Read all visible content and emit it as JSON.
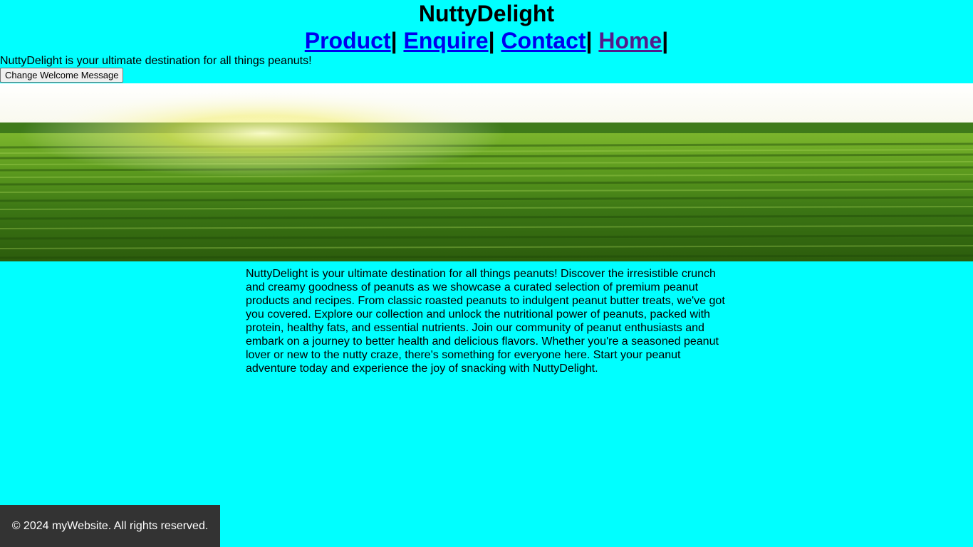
{
  "header": {
    "title": "NuttyDelight",
    "nav": [
      {
        "label": "Product"
      },
      {
        "label": "Enquire"
      },
      {
        "label": "Contact"
      },
      {
        "label": "Home"
      }
    ],
    "separator": "|"
  },
  "welcome": {
    "message": "NuttyDelight is your ultimate destination for all things peanuts!",
    "button_label": "Change Welcome Message"
  },
  "main": {
    "paragraph": "NuttyDelight is your ultimate destination for all things peanuts! Discover the irresistible crunch and creamy goodness of peanuts as we showcase a curated selection of premium peanut products and recipes. From classic roasted peanuts to indulgent peanut butter treats, we've got you covered. Explore our collection and unlock the nutritional power of peanuts, packed with protein, healthy fats, and essential nutrients. Join our community of peanut enthusiasts and embark on a journey to better health and delicious flavors. Whether you're a seasoned peanut lover or new to the nutty craze, there's something for everyone here. Start your peanut adventure today and experience the joy of snacking with NuttyDelight."
  },
  "footer": {
    "text": "© 2024 myWebsite. All rights reserved."
  },
  "colors": {
    "background": "#00ffff",
    "link": "#0000ee",
    "visited_link": "#551a8b",
    "footer_bg": "#333333"
  }
}
